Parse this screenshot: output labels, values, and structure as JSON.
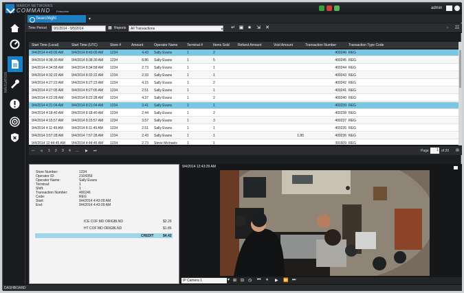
{
  "app": {
    "brand_top": "MARCH NETWORKS",
    "brand_main": "COMMAND",
    "brand_edition": "Enterprise",
    "user": "admin",
    "sidebar_label": "NAVIGATION",
    "status_label": "DASHBOARD"
  },
  "tab": {
    "label": "Searchlight",
    "add_label": "▾"
  },
  "toolbar": {
    "period_label": "Time Period",
    "period_value": "9/1/2014 - 9/5/2014",
    "reports_label": "Reports",
    "reports_value": "All Transactions"
  },
  "table": {
    "headers": [
      "Start Time (Local)",
      "Start Time (UTC)",
      "Store #",
      "Amount",
      "Operator Name",
      "Terminal #",
      "Items Sold",
      "Refund Amount",
      "Void Amount",
      "Transaction Number",
      "Transaction Type Code"
    ],
    "rows": [
      [
        "9/4/2014 4:43:09 AM",
        "9/4/2014 8:43:09 AM",
        "1234",
        "4.43",
        "Sally Evans",
        "1",
        "2",
        "",
        "",
        "400246",
        "REG"
      ],
      [
        "9/4/2014 4:38:30 AM",
        "9/4/2014 8:38:30 AM",
        "1234",
        "8.86",
        "Sally Evans",
        "1",
        "5",
        "",
        "",
        "400245",
        "REG"
      ],
      [
        "9/4/2014 4:34:58 AM",
        "9/4/2014 8:34:58 AM",
        "1234",
        "2.73",
        "Sally Evans",
        "1",
        "1",
        "",
        "",
        "400244",
        "REG"
      ],
      [
        "9/4/2014 4:32:22 AM",
        "9/4/2014 8:32:22 AM",
        "1234",
        "2.33",
        "Sally Evans",
        "1",
        "1",
        "",
        "",
        "400243",
        "REG"
      ],
      [
        "9/4/2014 4:27:23 AM",
        "9/4/2014 8:27:23 AM",
        "1234",
        "4.15",
        "Sally Evans",
        "1",
        "2",
        "",
        "",
        "400242",
        "REG"
      ],
      [
        "9/4/2014 4:27:05 AM",
        "9/4/2014 8:27:05 AM",
        "1234",
        "2.51",
        "Sally Evans",
        "1",
        "1",
        "",
        "",
        "400241",
        "REG"
      ],
      [
        "9/4/2014 4:22:28 AM",
        "9/4/2014 8:22:28 AM",
        "1234",
        "4.37",
        "Sally Evans",
        "1",
        "2",
        "",
        "",
        "400240",
        "REG"
      ],
      [
        "9/4/2014 4:21:04 AM",
        "9/4/2014 8:21:04 AM",
        "1234",
        "3.41",
        "Sally Evans",
        "1",
        "1",
        "",
        "",
        "400239",
        "REG"
      ],
      [
        "9/4/2014 4:18:40 AM",
        "9/4/2014 8:18:40 AM",
        "1234",
        "2.44",
        "Sally Evans",
        "1",
        "2",
        "",
        "",
        "400238",
        "REG"
      ],
      [
        "9/4/2014 4:15:57 AM",
        "9/4/2014 8:15:57 AM",
        "1234",
        "3.57",
        "Sally Evans",
        "1",
        "3",
        "",
        "",
        "400237",
        "REG"
      ],
      [
        "9/4/2014 4:11:49 AM",
        "9/4/2014 8:11:49 AM",
        "1234",
        "2.51",
        "Sally Evans",
        "1",
        "1",
        "",
        "",
        "400235",
        "REG"
      ],
      [
        "9/4/2014 3:57:28 AM",
        "9/4/2014 7:57:28 AM",
        "1234",
        "2.43",
        "Sally Evans",
        "1",
        "1",
        "",
        "1.85",
        "400236",
        "REG"
      ],
      [
        "9/4/2014 12:44:45 AM",
        "9/4/2014 4:44:45 AM",
        "1234",
        "2.73",
        "Steve Michaels",
        "1",
        "1",
        "",
        "",
        "391609",
        "REG"
      ]
    ],
    "selected_rows": [
      0,
      7
    ]
  },
  "pager": {
    "pages": [
      "1",
      "2",
      "3",
      "4",
      "..."
    ],
    "page_label": "Page",
    "page_value": "1",
    "page_total": "of 20"
  },
  "receipt": {
    "fields": [
      {
        "label": "Store Number:",
        "value": "1234"
      },
      {
        "label": "Operator ID:",
        "value": "2104359"
      },
      {
        "label": "Operator Name:",
        "value": "Sally Evans"
      },
      {
        "label": "Terminal:",
        "value": "1"
      },
      {
        "label": "Shift:",
        "value": "1"
      },
      {
        "label": "Transaction Number:",
        "value": "400246"
      },
      {
        "label": "Code:",
        "value": "REG"
      },
      {
        "label": "Start:",
        "value": "9/4/2014 4:43:09 AM"
      },
      {
        "label": "End:",
        "value": "9/4/2014 4:43:09 AM"
      }
    ],
    "items": [
      {
        "name": "ICE COF MD ORIGBLND",
        "price": "$2.29"
      },
      {
        "name": "HT COF MD ORIGBLND",
        "price": "$1.85"
      }
    ],
    "credit_label": "CREDIT",
    "credit_value": "$4.42"
  },
  "video": {
    "timestamp": "9/4/2014 12:43:29 AM",
    "camera": "IP Camera 1"
  }
}
